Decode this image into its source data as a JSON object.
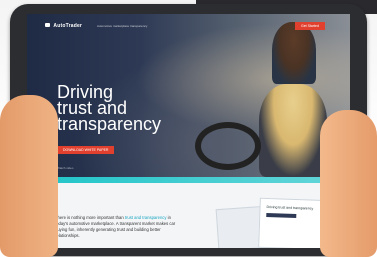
{
  "header": {
    "logo_text": "AutoTrader",
    "tagline": "Automotive marketplace transparency",
    "top_cta": "Get Started"
  },
  "hero": {
    "headline_lines": [
      "Driving",
      "trust and",
      "transparency"
    ],
    "cta_label": "DOWNLOAD WHITE PAPER",
    "video_label": "Watch video"
  },
  "intro": {
    "text_before_link": "There is nothing more important than ",
    "link_text": "trust and transparency",
    "text_after_link": " in today's automotive marketplace. A transparent market makes car buying fun, inherently generating trust and building better relationships."
  },
  "document": {
    "title": "Driving trust and transparency"
  },
  "colors": {
    "accent": "#e2402f",
    "teal": "#1ec4c8",
    "hero_dark": "#1f2b45"
  }
}
